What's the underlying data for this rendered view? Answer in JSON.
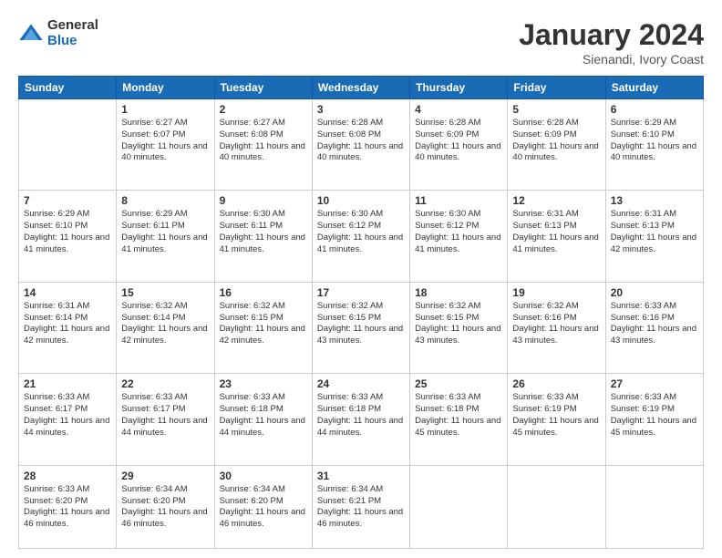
{
  "header": {
    "logo_general": "General",
    "logo_blue": "Blue",
    "month_title": "January 2024",
    "location": "Sienandi, Ivory Coast"
  },
  "days_of_week": [
    "Sunday",
    "Monday",
    "Tuesday",
    "Wednesday",
    "Thursday",
    "Friday",
    "Saturday"
  ],
  "weeks": [
    [
      {
        "day": "",
        "info": ""
      },
      {
        "day": "1",
        "info": "Sunrise: 6:27 AM\nSunset: 6:07 PM\nDaylight: 11 hours and 40 minutes."
      },
      {
        "day": "2",
        "info": "Sunrise: 6:27 AM\nSunset: 6:08 PM\nDaylight: 11 hours and 40 minutes."
      },
      {
        "day": "3",
        "info": "Sunrise: 6:28 AM\nSunset: 6:08 PM\nDaylight: 11 hours and 40 minutes."
      },
      {
        "day": "4",
        "info": "Sunrise: 6:28 AM\nSunset: 6:09 PM\nDaylight: 11 hours and 40 minutes."
      },
      {
        "day": "5",
        "info": "Sunrise: 6:28 AM\nSunset: 6:09 PM\nDaylight: 11 hours and 40 minutes."
      },
      {
        "day": "6",
        "info": "Sunrise: 6:29 AM\nSunset: 6:10 PM\nDaylight: 11 hours and 40 minutes."
      }
    ],
    [
      {
        "day": "7",
        "info": "Sunrise: 6:29 AM\nSunset: 6:10 PM\nDaylight: 11 hours and 41 minutes."
      },
      {
        "day": "8",
        "info": "Sunrise: 6:29 AM\nSunset: 6:11 PM\nDaylight: 11 hours and 41 minutes."
      },
      {
        "day": "9",
        "info": "Sunrise: 6:30 AM\nSunset: 6:11 PM\nDaylight: 11 hours and 41 minutes."
      },
      {
        "day": "10",
        "info": "Sunrise: 6:30 AM\nSunset: 6:12 PM\nDaylight: 11 hours and 41 minutes."
      },
      {
        "day": "11",
        "info": "Sunrise: 6:30 AM\nSunset: 6:12 PM\nDaylight: 11 hours and 41 minutes."
      },
      {
        "day": "12",
        "info": "Sunrise: 6:31 AM\nSunset: 6:13 PM\nDaylight: 11 hours and 41 minutes."
      },
      {
        "day": "13",
        "info": "Sunrise: 6:31 AM\nSunset: 6:13 PM\nDaylight: 11 hours and 42 minutes."
      }
    ],
    [
      {
        "day": "14",
        "info": "Sunrise: 6:31 AM\nSunset: 6:14 PM\nDaylight: 11 hours and 42 minutes."
      },
      {
        "day": "15",
        "info": "Sunrise: 6:32 AM\nSunset: 6:14 PM\nDaylight: 11 hours and 42 minutes."
      },
      {
        "day": "16",
        "info": "Sunrise: 6:32 AM\nSunset: 6:15 PM\nDaylight: 11 hours and 42 minutes."
      },
      {
        "day": "17",
        "info": "Sunrise: 6:32 AM\nSunset: 6:15 PM\nDaylight: 11 hours and 43 minutes."
      },
      {
        "day": "18",
        "info": "Sunrise: 6:32 AM\nSunset: 6:15 PM\nDaylight: 11 hours and 43 minutes."
      },
      {
        "day": "19",
        "info": "Sunrise: 6:32 AM\nSunset: 6:16 PM\nDaylight: 11 hours and 43 minutes."
      },
      {
        "day": "20",
        "info": "Sunrise: 6:33 AM\nSunset: 6:16 PM\nDaylight: 11 hours and 43 minutes."
      }
    ],
    [
      {
        "day": "21",
        "info": "Sunrise: 6:33 AM\nSunset: 6:17 PM\nDaylight: 11 hours and 44 minutes."
      },
      {
        "day": "22",
        "info": "Sunrise: 6:33 AM\nSunset: 6:17 PM\nDaylight: 11 hours and 44 minutes."
      },
      {
        "day": "23",
        "info": "Sunrise: 6:33 AM\nSunset: 6:18 PM\nDaylight: 11 hours and 44 minutes."
      },
      {
        "day": "24",
        "info": "Sunrise: 6:33 AM\nSunset: 6:18 PM\nDaylight: 11 hours and 44 minutes."
      },
      {
        "day": "25",
        "info": "Sunrise: 6:33 AM\nSunset: 6:18 PM\nDaylight: 11 hours and 45 minutes."
      },
      {
        "day": "26",
        "info": "Sunrise: 6:33 AM\nSunset: 6:19 PM\nDaylight: 11 hours and 45 minutes."
      },
      {
        "day": "27",
        "info": "Sunrise: 6:33 AM\nSunset: 6:19 PM\nDaylight: 11 hours and 45 minutes."
      }
    ],
    [
      {
        "day": "28",
        "info": "Sunrise: 6:33 AM\nSunset: 6:20 PM\nDaylight: 11 hours and 46 minutes."
      },
      {
        "day": "29",
        "info": "Sunrise: 6:34 AM\nSunset: 6:20 PM\nDaylight: 11 hours and 46 minutes."
      },
      {
        "day": "30",
        "info": "Sunrise: 6:34 AM\nSunset: 6:20 PM\nDaylight: 11 hours and 46 minutes."
      },
      {
        "day": "31",
        "info": "Sunrise: 6:34 AM\nSunset: 6:21 PM\nDaylight: 11 hours and 46 minutes."
      },
      {
        "day": "",
        "info": ""
      },
      {
        "day": "",
        "info": ""
      },
      {
        "day": "",
        "info": ""
      }
    ]
  ]
}
